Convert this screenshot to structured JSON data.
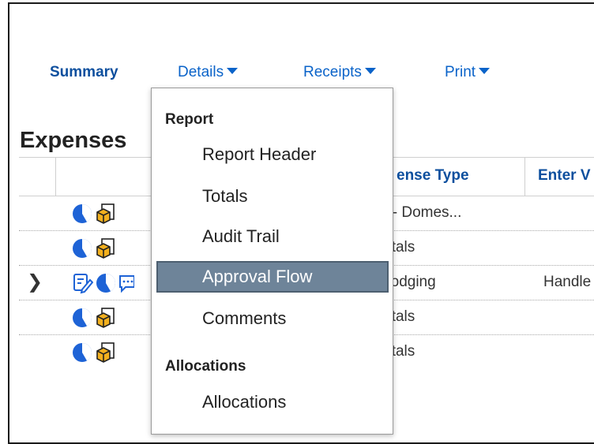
{
  "nav": {
    "summary": "Summary",
    "details": "Details",
    "receipts": "Receipts",
    "print": "Print"
  },
  "section_title": "Expenses",
  "table": {
    "columns": [
      "Expense Type",
      "Enter V"
    ],
    "visible_prefix": [
      "ense Type",
      "Enter V"
    ],
    "rows": [
      {
        "type": "Other - Domes...",
        "vendor": "",
        "expandable": false
      },
      {
        "type": "Incidentals",
        "vendor": "",
        "expandable": false
      },
      {
        "type": "Hotel/Lodging",
        "vendor": "Handle",
        "expandable": true
      },
      {
        "type": "Incidentals",
        "vendor": "",
        "expandable": false
      },
      {
        "type": "Incidentals",
        "vendor": "",
        "expandable": false
      }
    ],
    "rows_visible": [
      "ner - Domes...",
      "dentals",
      "el/Lodging",
      "dentals",
      "dentals"
    ]
  },
  "dropdown": {
    "report_header": "Report",
    "items": [
      "Report Header",
      "Totals",
      "Audit Trail",
      "Approval Flow",
      "Comments"
    ],
    "active_item": "Approval Flow",
    "alloc_header": "Allocations",
    "alloc_items": [
      "Allocations"
    ]
  },
  "colors": {
    "link": "#0a63c9",
    "header_text": "#0d4f9e",
    "highlight": "#6e8499",
    "pie_icon": "#1e63d6",
    "receipt_icon": "#f2b01e"
  },
  "icons": [
    "pie-chart-icon",
    "receipt-cube-icon",
    "edit-note-icon",
    "comment-icon",
    "chevron-right-icon",
    "caret-down-icon"
  ]
}
